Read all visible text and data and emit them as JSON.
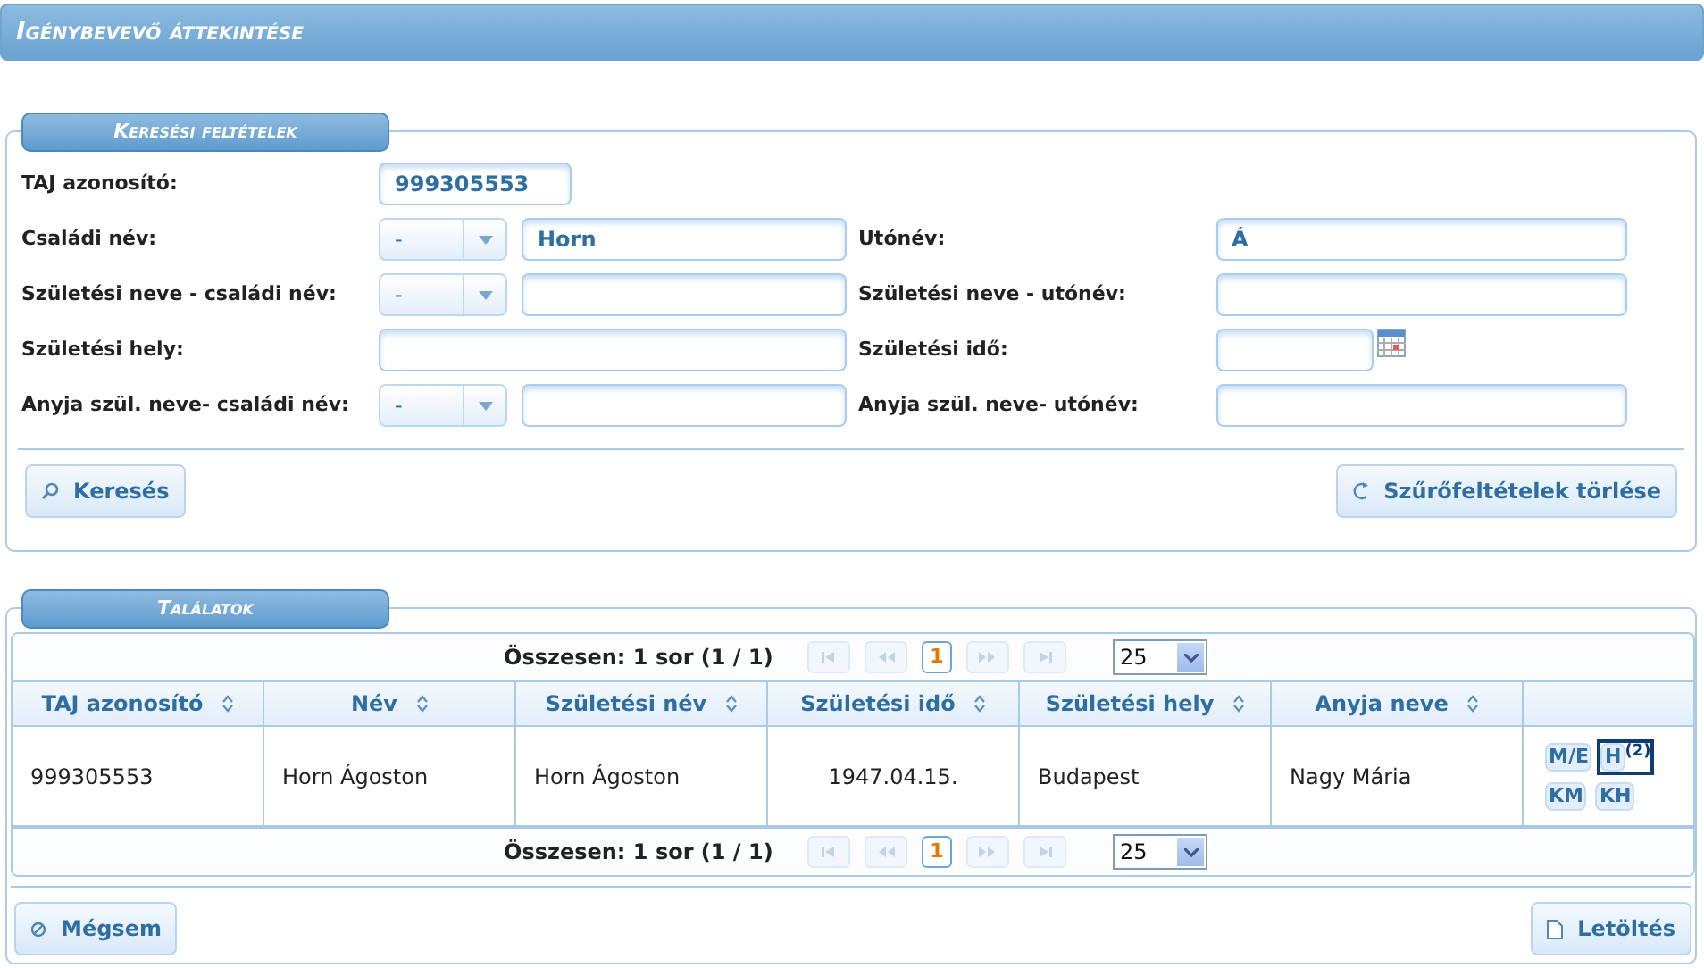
{
  "page_title": "Igénybevevő áttekintése",
  "search": {
    "legend": "Keresési feltételek",
    "rows": [
      {
        "left": {
          "kind": "text_short",
          "label": "TAJ azonosító:",
          "value": "999305553"
        },
        "right": null
      },
      {
        "left": {
          "kind": "select_text",
          "label": "Családi név:",
          "select": "-",
          "value": "Horn"
        },
        "right": {
          "kind": "text_long",
          "label": "Utónév:",
          "value": "Á"
        }
      },
      {
        "left": {
          "kind": "select_text",
          "label": "Születési neve - családi név:",
          "select": "-"
        },
        "right": {
          "kind": "text_long",
          "label": "Születési neve - utónév:"
        }
      },
      {
        "left": {
          "kind": "text_wide",
          "label": "Születési hely:"
        },
        "right": {
          "kind": "date",
          "label": "Születési idő:"
        }
      },
      {
        "left": {
          "kind": "select_text",
          "label": "Anyja szül. neve- családi név:",
          "select": "-"
        },
        "right": {
          "kind": "text_long",
          "label": "Anyja szül. neve- utónév:"
        }
      }
    ],
    "search_button": "Keresés",
    "clear_button": "Szűrőfeltételek törlése"
  },
  "results": {
    "legend": "Találatok",
    "top_pager": {
      "summary": "Összesen: 1 sor (1 / 1)",
      "pages": [
        {
          "label": "1",
          "selected": true
        }
      ],
      "page_size": "25"
    },
    "columns": [
      "TAJ azonosító",
      "Név",
      "Születési név",
      "Születési idő",
      "Születési hely",
      "Anyja neve"
    ],
    "rows": [
      {
        "cells": [
          "999305553",
          "Horn Ágoston",
          "Horn Ágoston",
          "1947.04.15.",
          "Budapest",
          "Nagy Mária"
        ],
        "actions": [
          {
            "label": "M/E",
            "selected": false
          },
          {
            "label": "H",
            "selected": true,
            "count": "(2)"
          },
          {
            "label": "KM",
            "selected": false
          },
          {
            "label": "KH",
            "selected": false
          }
        ]
      }
    ],
    "bottom_pager": {
      "summary": "Összesen: 1 sor (1 / 1)",
      "pages": [
        {
          "label": "1",
          "selected": true
        }
      ],
      "page_size": "25"
    }
  },
  "footer": {
    "cancel_button": "Mégsem",
    "download_button": "Letöltés"
  }
}
